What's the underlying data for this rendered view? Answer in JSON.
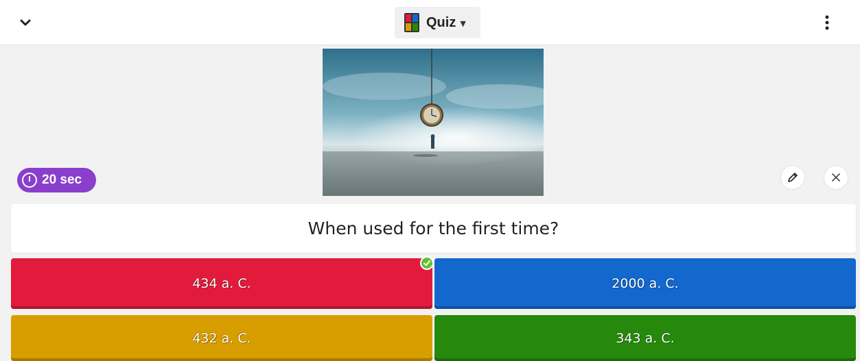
{
  "header": {
    "mode_label": "Quiz",
    "collapse_icon": "chevron-down-icon",
    "mode_icon": "quiz-shapes-icon",
    "caret_icon": "caret-down-icon",
    "more_icon": "more-vertical-icon"
  },
  "timer": {
    "label": "20 sec",
    "icon": "clock-icon",
    "color": "#8a3fcc"
  },
  "media": {
    "icon": "surreal-clock-image"
  },
  "actions": {
    "edit_icon": "pencil-icon",
    "remove_icon": "close-icon"
  },
  "question": {
    "text": "When used for the first time?"
  },
  "answers": [
    {
      "text": "434 a. C.",
      "color": "#e21b3c",
      "correct": true
    },
    {
      "text": "2000 a. C.",
      "color": "#1368ce",
      "correct": false
    },
    {
      "text": "432 a. C.",
      "color": "#d89e00",
      "correct": false
    },
    {
      "text": "343 a. C.",
      "color": "#26890c",
      "correct": false
    }
  ],
  "correct_badge_icon": "check-circle-icon"
}
